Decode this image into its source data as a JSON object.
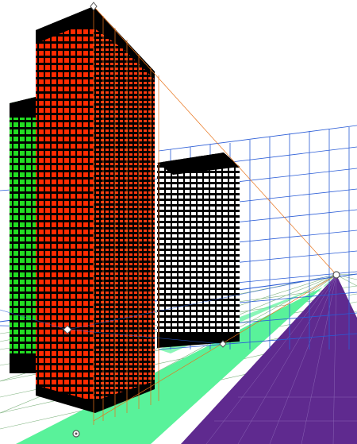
{
  "canvas": {
    "background": "#ffffff",
    "colors": {
      "red_building": "#ff2a00",
      "red_building_dark": "#c41a00",
      "green_building": "#22dd22",
      "white_building": "#ffffff",
      "roof_black": "#000000",
      "road_green": "#59f29a",
      "road_purple": "#5f2a8f",
      "perspective_grid_blue": "#2a5cd6",
      "perspective_grid_orange": "#e8731a",
      "ground_grid_green": "#5fa05f",
      "horizon_line": "#2a5cd6"
    },
    "icons": {
      "vanishing_point_handle": "circle-handle-icon",
      "anchor_handles": "diamond-handle-icon",
      "ground_handle": "target-handle-icon"
    }
  }
}
